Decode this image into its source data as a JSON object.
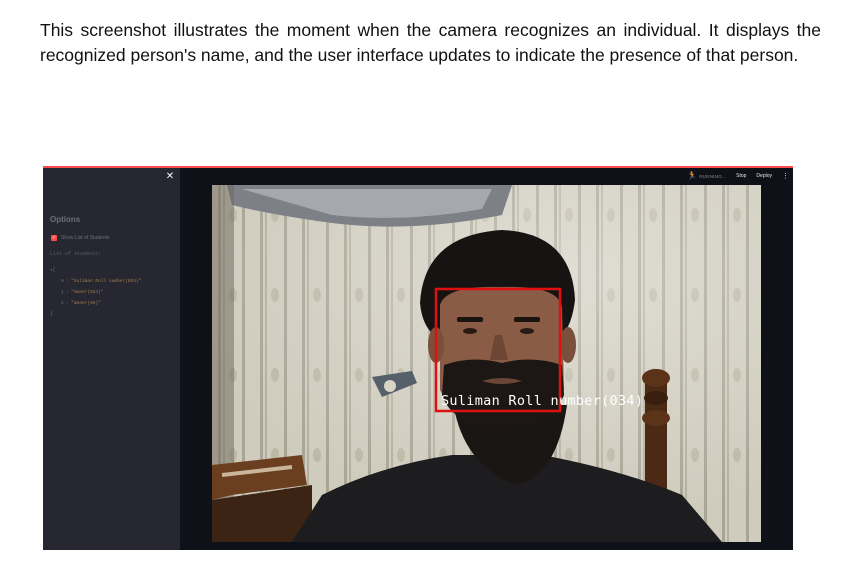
{
  "caption": "This screenshot illustrates the moment when the camera recognizes an individual. It displays the recognized person's name, and the user interface updates to indicate the presence of that person.",
  "sidebar": {
    "close_icon": "close-icon",
    "options_title": "Options",
    "checkbox_label": "Show List of Students",
    "checkbox_checked": true,
    "list_heading": "List of students:",
    "json_open": "▾[",
    "json_close": "]",
    "students": [
      {
        "index": "0 :",
        "value": "\"Suliman Roll number(034)\""
      },
      {
        "index": "1 :",
        "value": "\"Ameer(024)\""
      },
      {
        "index": "2 :",
        "value": "\"ameer(06)\""
      }
    ]
  },
  "topbar": {
    "running_icon": "running-person-icon",
    "status_text": "RUNNING...",
    "stop_label": "Stop",
    "deploy_label": "Deploy",
    "menu_icon": "⋮"
  },
  "camera": {
    "detection_label": "Suliman Roll number(034)",
    "box_color": "#e01010"
  },
  "colors": {
    "accent": "#ff4b4b",
    "sidebar_bg": "#262730",
    "app_bg": "#0e1117"
  }
}
